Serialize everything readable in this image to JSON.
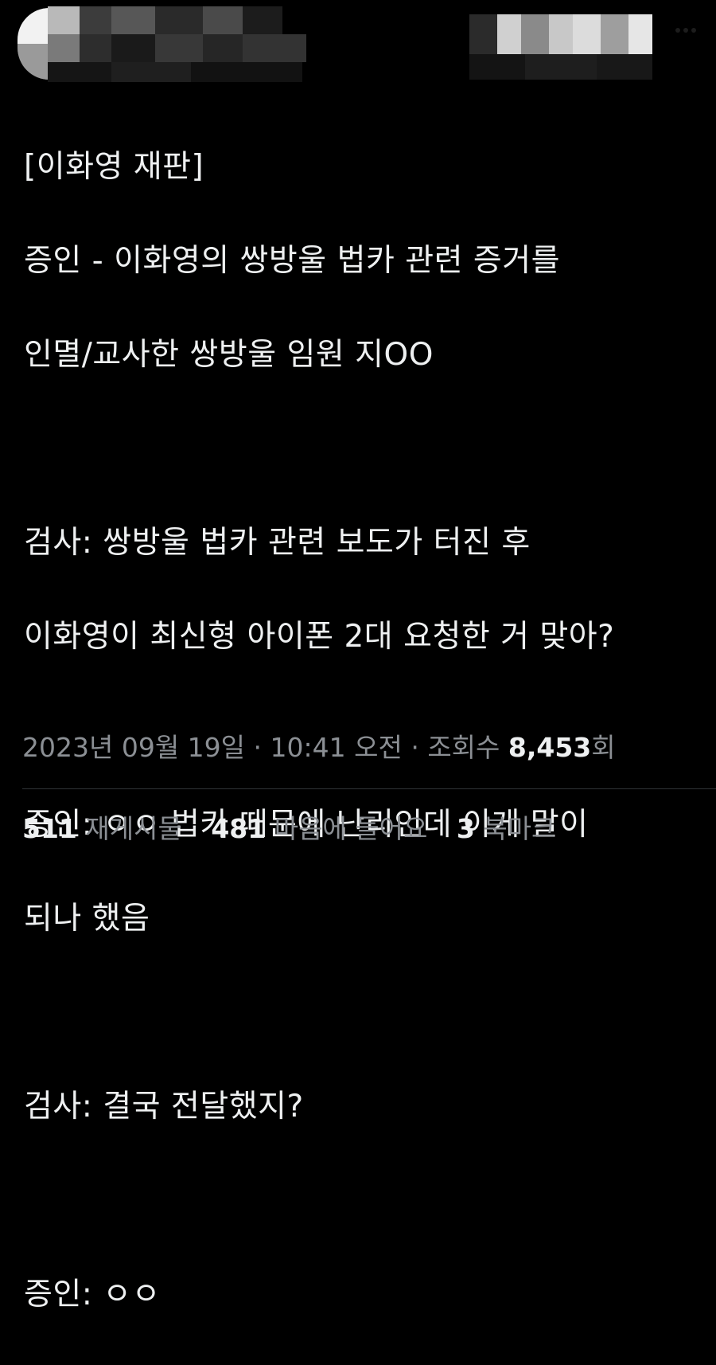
{
  "tweet": {
    "lines": [
      "[이화영 재판]",
      "증인 - 이화영의 쌍방울 법카 관련 증거를",
      "인멸/교사한 쌍방울 임원 지OO",
      "",
      "검사: 쌍방울 법카 관련 보도가 터진 후",
      "이화영이 최신형 아이폰 2대 요청한 거 맞아?",
      "",
      "증인: ㅇㅇ 법카 때문에 난리인데 이게 말이",
      "되나 했음",
      "",
      "검사: 결국 전달했지?",
      "",
      "증인: ㅇㅇ"
    ]
  },
  "meta": {
    "date": "2023년 09월 19일",
    "separator": " · ",
    "time": "10:41 오전",
    "views_label": "조회수 ",
    "views_count": "8,453",
    "views_suffix": "회"
  },
  "stats": {
    "retweets_count": "511",
    "retweets_label": " 재게시물",
    "likes_count": "481",
    "likes_label": " 마음에 들어요",
    "bookmarks_count": "3",
    "bookmarks_label": " 북마크"
  },
  "colors": {
    "background": "#000000",
    "text": "#e7e9ea",
    "muted": "#8b8f94",
    "divider": "#2f3336"
  }
}
